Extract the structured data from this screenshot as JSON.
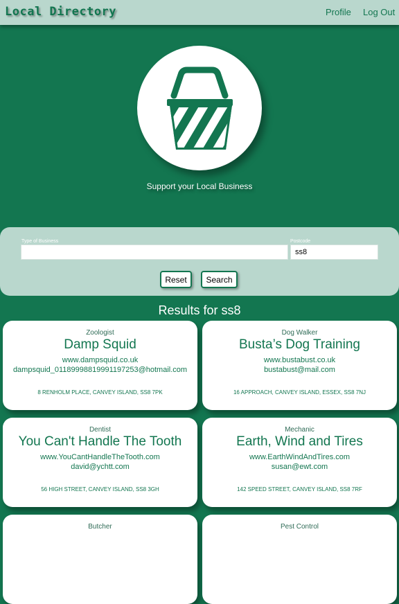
{
  "app": {
    "title": "Local Directory"
  },
  "nav": {
    "profile": "Profile",
    "logout": "Log Out"
  },
  "hero": {
    "icon": "shopping-basket-icon",
    "tagline": "Support your Local Business"
  },
  "search": {
    "business_type_label": "Type of Business",
    "business_type_value": "",
    "postcode_label": "Postcode",
    "postcode_value": "ss8",
    "reset_label": "Reset",
    "search_label": "Search"
  },
  "results": {
    "heading": "Results for ss8",
    "cards": [
      {
        "category": "Zoologist",
        "name": "Damp Squid",
        "website": "www.dampsquid.co.uk",
        "email": "dampsquid_01189998819991197253@hotmail.com",
        "address": "8 RENHOLM PLACE, CANVEY ISLAND, SS8 7PK"
      },
      {
        "category": "Dog Walker",
        "name": "Busta’s Dog Training",
        "website": "www.bustabust.co.uk",
        "email": "bustabust@mail.com",
        "address": "16 APPROACH, CANVEY ISLAND, ESSEX, SS8 7NJ"
      },
      {
        "category": "Dentist",
        "name": "You Can't Handle The Tooth",
        "website": "www.YouCantHandleTheTooth.com",
        "email": "david@ychtt.com",
        "address": "56 HIGH STREET, CANVEY ISLAND, SS8 3GH"
      },
      {
        "category": "Mechanic",
        "name": "Earth, Wind and Tires",
        "website": "www.EarthWindAndTires.com",
        "email": "susan@ewt.com",
        "address": "142 SPEED STREET, CANVEY ISLAND, SS8 7RF"
      },
      {
        "category": "Butcher"
      },
      {
        "category": "Pest Control"
      }
    ]
  },
  "colors": {
    "primary": "#137650",
    "panel": "#b9d7cd",
    "card": "#ffffff"
  }
}
